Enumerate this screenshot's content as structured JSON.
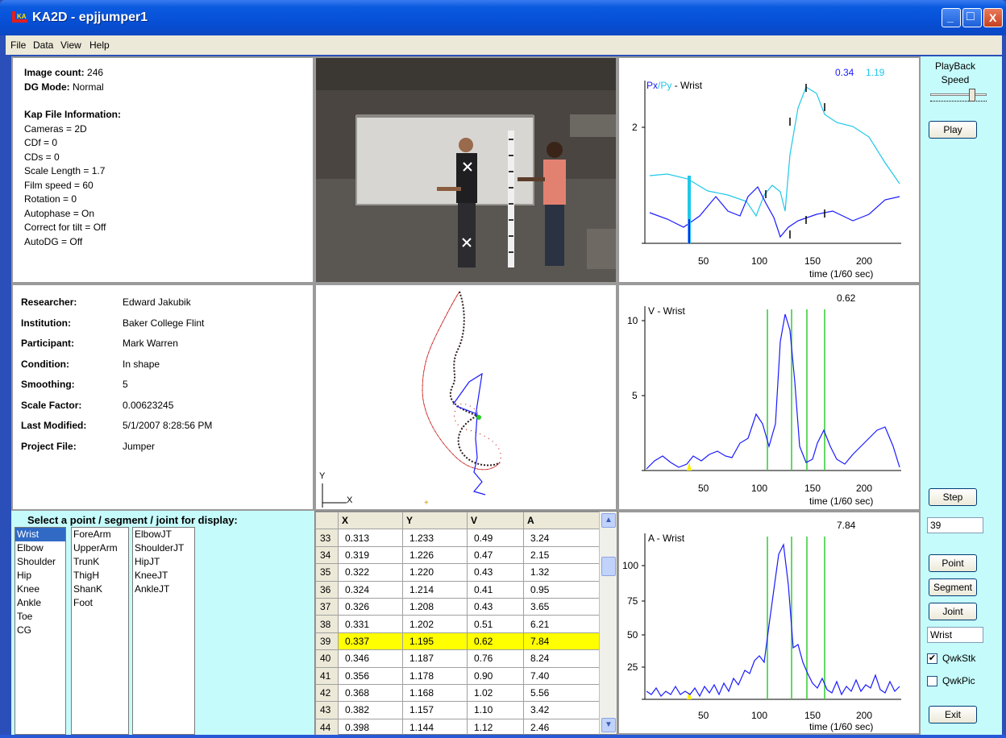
{
  "window": {
    "title": "KA2D - epjjumper1",
    "min_symbol": "_",
    "max_symbol": "□",
    "close_symbol": "X"
  },
  "menu": [
    "File",
    "Data",
    "View",
    "Help"
  ],
  "info": {
    "image_count_label": "Image count:",
    "image_count": "246",
    "dg_mode_label": "DG Mode:",
    "dg_mode": "Normal",
    "kap_heading": "Kap File Information:",
    "lines": [
      "Cameras = 2D",
      "CDf = 0",
      "CDs = 0",
      "Scale Length = 1.7",
      "Film speed = 60",
      "Rotation = 0",
      "Autophase = On",
      "Correct for tilt = Off",
      "AutoDG = Off"
    ]
  },
  "meta": [
    {
      "label": "Researcher:",
      "value": "Edward Jakubik"
    },
    {
      "label": "Institution:",
      "value": "Baker College Flint"
    },
    {
      "label": "Participant:",
      "value": "Mark Warren"
    },
    {
      "label": "Condition:",
      "value": "In shape"
    },
    {
      "label": "Smoothing:",
      "value": "5"
    },
    {
      "label": "Scale Factor:",
      "value": "0.00623245"
    },
    {
      "label": "Last Modified:",
      "value": "5/1/2007 8:28:56 PM"
    },
    {
      "label": "Project File:",
      "value": "Jumper"
    }
  ],
  "path_axes": {
    "y": "Y",
    "x": "X"
  },
  "select": {
    "title": "Select a point / segment / joint for display:",
    "points": [
      "Wrist",
      "Elbow",
      "Shoulder",
      "Hip",
      "Knee",
      "Ankle",
      "Toe",
      "CG"
    ],
    "segments": [
      "ForeArm",
      "UpperArm",
      "TrunK",
      "ThigH",
      "ShanK",
      "Foot"
    ],
    "joints": [
      "ElbowJT",
      "ShoulderJT",
      "HipJT",
      "KneeJT",
      "AnkleJT"
    ],
    "selected": "Wrist"
  },
  "table": {
    "headers": [
      "X",
      "Y",
      "V",
      "A"
    ],
    "rows": [
      [
        "33",
        "0.313",
        "1.233",
        "0.49",
        "3.24"
      ],
      [
        "34",
        "0.319",
        "1.226",
        "0.47",
        "2.15"
      ],
      [
        "35",
        "0.322",
        "1.220",
        "0.43",
        "1.32"
      ],
      [
        "36",
        "0.324",
        "1.214",
        "0.41",
        "0.95"
      ],
      [
        "37",
        "0.326",
        "1.208",
        "0.43",
        "3.65"
      ],
      [
        "38",
        "0.331",
        "1.202",
        "0.51",
        "6.21"
      ],
      [
        "39",
        "0.337",
        "1.195",
        "0.62",
        "7.84"
      ],
      [
        "40",
        "0.346",
        "1.187",
        "0.76",
        "8.24"
      ],
      [
        "41",
        "0.356",
        "1.178",
        "0.90",
        "7.40"
      ],
      [
        "42",
        "0.368",
        "1.168",
        "1.02",
        "5.56"
      ],
      [
        "43",
        "0.382",
        "1.157",
        "1.10",
        "3.42"
      ],
      [
        "44",
        "0.398",
        "1.144",
        "1.12",
        "2.46"
      ]
    ],
    "highlight_row": "39",
    "up_arrow": "▲",
    "down_arrow": "▼"
  },
  "graphs": {
    "position": {
      "label_px": "Px",
      "label_sep": "/",
      "label_py": "Py",
      "label_rest": " - Wrist",
      "val1": "0.34",
      "val2": "1.19",
      "yticks": [
        "2"
      ],
      "xlabel": "time (1/60 sec)",
      "xticks": [
        "50",
        "100",
        "150",
        "200"
      ]
    },
    "velocity": {
      "label": "V - Wrist",
      "value": "0.62",
      "yticks": [
        "10",
        "5"
      ],
      "xlabel": "time (1/60 sec)",
      "xticks": [
        "50",
        "100",
        "150",
        "200"
      ]
    },
    "acceleration": {
      "label": "A - Wrist",
      "value": "7.84",
      "yticks": [
        "100",
        "75",
        "50",
        "25"
      ],
      "xlabel": "time (1/60 sec)",
      "xticks": [
        "50",
        "100",
        "150",
        "200"
      ]
    }
  },
  "controls": {
    "playback_label": "PlayBack\nSpeed",
    "play": "Play",
    "step": "Step",
    "frame": "39",
    "point": "Point",
    "segment": "Segment",
    "joint": "Joint",
    "selected_name": "Wrist",
    "qwkstk": "QwkStk",
    "qwkstk_checked": "✔",
    "qwkpic": "QwkPic",
    "exit": "Exit"
  },
  "colors": {
    "py_series": "#1fc8e8",
    "px_series": "#1a1aff",
    "event_lines": "#33cc33",
    "highlight": "#ffff00"
  }
}
